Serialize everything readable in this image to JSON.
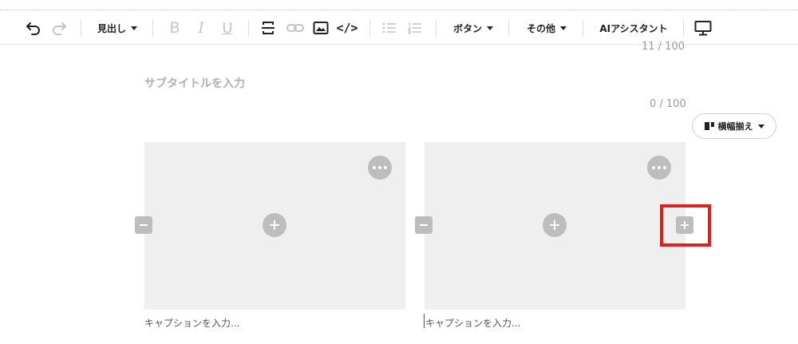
{
  "toolbar": {
    "undo_icon": "undo-icon",
    "redo_icon": "redo-icon",
    "heading_label": "見出し",
    "bold_label": "B",
    "italic_label": "I",
    "underline_label": "U",
    "divider_icon": "horizontal-rule-icon",
    "link_icon": "link-icon",
    "image_icon": "image-icon",
    "code_icon": "code-icon",
    "code_label": "</>",
    "bullet_list_icon": "bullet-list-icon",
    "numbered_list_icon": "numbered-list-icon",
    "button_label": "ボタン",
    "other_label": "その他",
    "ai_label": "AIアシスタント",
    "preview_icon": "monitor-icon"
  },
  "title_counter": "11 / 100",
  "subtitle": {
    "placeholder": "サブタイトルを入力",
    "counter": "0 / 100"
  },
  "align_button": {
    "label": "横幅揃え",
    "icon": "layout-columns-icon"
  },
  "images": [
    {
      "caption_placeholder": "キャプションを入力..."
    },
    {
      "caption_placeholder": "キャプションを入力..."
    }
  ],
  "colors": {
    "highlight": "#e0211b",
    "placeholder_bg": "#efefef",
    "control_gray": "#bdbdbd"
  }
}
